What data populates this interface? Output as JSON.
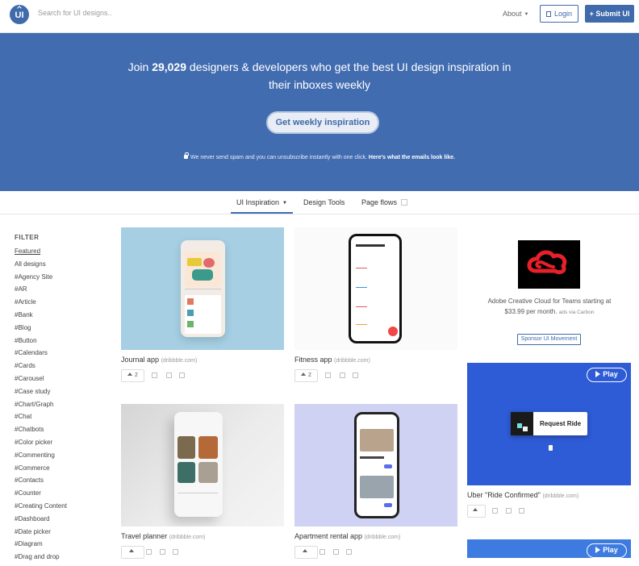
{
  "nav": {
    "logo_text": "UI",
    "search_placeholder": "Search for UI designs..",
    "about_label": "About",
    "login_label": "Login",
    "submit_label": "+ Submit UI"
  },
  "hero": {
    "title_prefix": "Join ",
    "title_count": "29,029",
    "title_suffix": " designers & developers who get the best UI design inspiration in their inboxes weekly",
    "cta_label": "Get weekly inspiration",
    "note_text": "We never send spam and you can unsubscribe instantly with one click. ",
    "note_link": "Here's what the emails look like."
  },
  "tabs": [
    {
      "label": "UI Inspiration",
      "active": true
    },
    {
      "label": "Design Tools",
      "active": false
    },
    {
      "label": "Page flows",
      "active": false
    }
  ],
  "sidebar": {
    "title": "FILTER",
    "items": [
      "Featured",
      "All designs",
      "#Agency Site",
      "#AR",
      "#Article",
      "#Bank",
      "#Blog",
      "#Button",
      "#Calendars",
      "#Cards",
      "#Carousel",
      "#Case study",
      "#Chart/Graph",
      "#Chat",
      "#Chatbots",
      "#Color picker",
      "#Commenting",
      "#Commerce",
      "#Contacts",
      "#Counter",
      "#Creating Content",
      "#Dashboard",
      "#Date picker",
      "#Diagram",
      "#Drag and drop"
    ]
  },
  "cards": [
    {
      "title": "Journal app",
      "source": "(dribbble.com)",
      "likes": "2"
    },
    {
      "title": "Fitness app",
      "source": "(dribbble.com)",
      "likes": "2"
    },
    {
      "title": "Travel planner",
      "source": "(dribbble.com)",
      "likes": ""
    },
    {
      "title": "Apartment rental app",
      "source": "(dribbble.com)",
      "likes": ""
    },
    {
      "title": "Uber \"Ride Confirmed\"",
      "source": "(dribbble.com)",
      "likes": ""
    }
  ],
  "ad": {
    "text": "Adobe Creative Cloud for Teams starting at $33.99 per month.",
    "via": "ads via Carbon",
    "sponsor_label": "Sponsor UI Movement"
  },
  "video": {
    "play_label": "Play",
    "request_ride_label": "Request Ride"
  },
  "colors": {
    "brand": "#426cb0",
    "ad_red": "#e8202a",
    "video_blue": "#2e5bd6"
  }
}
